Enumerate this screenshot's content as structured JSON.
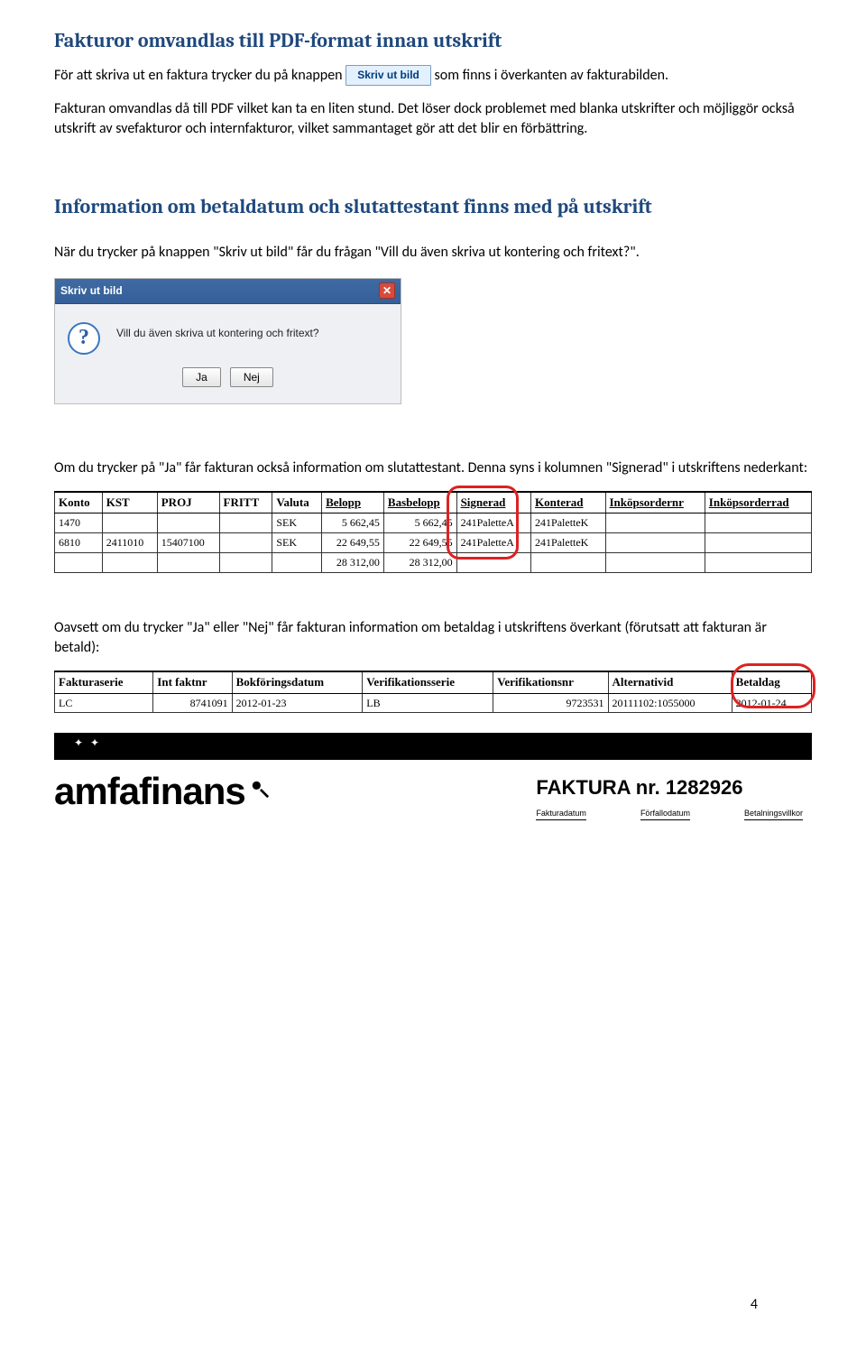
{
  "section1": {
    "title": "Fakturor omvandlas till PDF-format innan utskrift",
    "para1_a": "För att skriva ut en faktura trycker du på knappen ",
    "button_label": "Skriv ut bild",
    "para1_b": " som finns i överkanten av fakturabilden.",
    "para2": "Fakturan omvandlas då till PDF vilket kan ta en liten stund. Det löser dock problemet med blanka utskrifter och möjliggör också utskrift av svefakturor och internfakturor, vilket sammantaget gör att det blir en förbättring."
  },
  "section2": {
    "title": "Information om betaldatum och slutattestant finns med på utskrift",
    "para1": "När du trycker på knappen \"Skriv ut bild\" får du frågan \"Vill du även skriva ut kontering och fritext?\"."
  },
  "dialog": {
    "title": "Skriv ut bild",
    "text": "Vill du även skriva ut kontering och fritext?",
    "yes": "Ja",
    "no": "Nej"
  },
  "section3": {
    "para1": "Om du trycker på \"Ja\" får fakturan också information om slutattestant. Denna syns i kolumnen \"Signerad\" i utskriftens nederkant:"
  },
  "table1": {
    "headers": [
      "Konto",
      "KST",
      "PROJ",
      "FRITT",
      "Valuta",
      "Belopp",
      "Basbelopp",
      "Signerad",
      "Konterad",
      "Inköpsordernr",
      "Inköpsorderrad"
    ],
    "rows": [
      {
        "konto": "1470",
        "kst": "",
        "proj": "",
        "fritt": "",
        "valuta": "SEK",
        "belopp": "5 662,45",
        "basbelopp": "5 662,45",
        "signerad": "241PaletteA",
        "konterad": "241PaletteK",
        "iordnr": "",
        "iordr": ""
      },
      {
        "konto": "6810",
        "kst": "2411010",
        "proj": "15407100",
        "fritt": "",
        "valuta": "SEK",
        "belopp": "22 649,55",
        "basbelopp": "22 649,55",
        "signerad": "241PaletteA",
        "konterad": "241PaletteK",
        "iordnr": "",
        "iordr": ""
      },
      {
        "konto": "",
        "kst": "",
        "proj": "",
        "fritt": "",
        "valuta": "",
        "belopp": "28 312,00",
        "basbelopp": "28 312,00",
        "signerad": "",
        "konterad": "",
        "iordnr": "",
        "iordr": ""
      }
    ]
  },
  "section4": {
    "para1": "Oavsett om du trycker \"Ja\" eller \"Nej\" får fakturan information om betaldag i utskriftens överkant (förutsatt att fakturan är betald):"
  },
  "table2": {
    "headers": [
      "Fakturaserie",
      "Int faktnr",
      "Bokföringsdatum",
      "Verifikationsserie",
      "Verifikationsnr",
      "Alternativid",
      "Betaldag"
    ],
    "rows": [
      {
        "serie": "LC",
        "intfakt": "8741091",
        "bokf": "2012-01-23",
        "vserie": "LB",
        "vnr": "9723531",
        "altid": "20111102:1055000",
        "betaldag": "2012-01-24"
      }
    ]
  },
  "invoice": {
    "logo": "amfafinans",
    "faktura_label": "FAKTURA nr. 1282926",
    "col1": "Fakturadatum",
    "col2": "Förfallodatum",
    "col3": "Betalningsvillkor"
  },
  "page_number": "4"
}
